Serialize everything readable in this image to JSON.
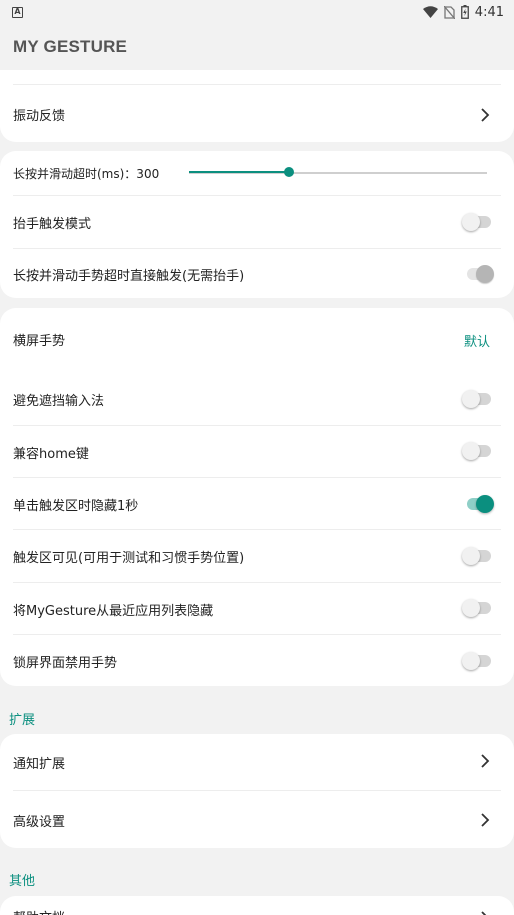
{
  "status_bar": {
    "notification_icon_text": "A",
    "time": "4:41",
    "icons": [
      "wifi-icon",
      "no-sim-icon",
      "battery-charging-icon"
    ]
  },
  "app": {
    "title": "MY GESTURE"
  },
  "colors": {
    "accent": "#0b8f7f",
    "background": "#f2f2f2",
    "card": "#ffffff"
  },
  "card1": {
    "vibration_feedback": "振动反馈"
  },
  "card2": {
    "long_press_timeout_label": "长按并滑动超时(ms)：300",
    "long_press_timeout_value": 300,
    "long_press_timeout_fraction": 0.335,
    "lift_trigger_mode": "抬手触发模式",
    "lift_trigger_mode_on": false,
    "direct_trigger_label": "长按并滑动手势超时直接触发(无需抬手)",
    "direct_trigger_on": true,
    "direct_trigger_disabled": true
  },
  "card3": {
    "landscape_gesture": "横屏手势",
    "landscape_gesture_value": "默认",
    "avoid_ime": "避免遮挡输入法",
    "avoid_ime_on": false,
    "home_compat": "兼容home键",
    "home_compat_on": false,
    "hide_on_tap": "单击触发区时隐藏1秒",
    "hide_on_tap_on": true,
    "trigger_visible": "触发区可见(可用于测试和习惯手势位置)",
    "trigger_visible_on": false,
    "hide_from_recents": "将MyGesture从最近应用列表隐藏",
    "hide_from_recents_on": false,
    "disable_on_lockscreen": "锁屏界面禁用手势",
    "disable_on_lockscreen_on": false
  },
  "section_extend": {
    "title": "扩展",
    "notification_extend": "通知扩展",
    "advanced_settings": "高级设置"
  },
  "section_other": {
    "title": "其他",
    "help_docs": "帮助文档"
  }
}
